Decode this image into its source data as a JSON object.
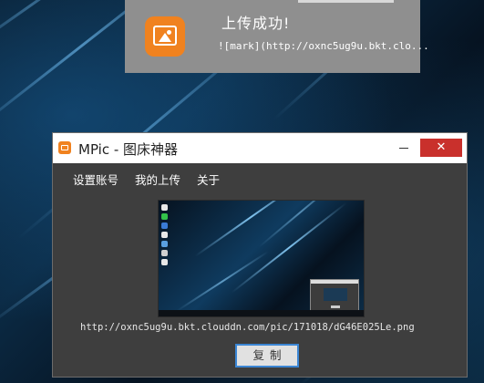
{
  "notification": {
    "title": "上传成功!",
    "message": "![mark](http://oxnc5ug9u.bkt.clo...",
    "icon": "image-icon",
    "accent": "#f0821f"
  },
  "window": {
    "title": "MPic - 图床神器",
    "minimize_label": "",
    "close_label": "✕",
    "menu": [
      "设置账号",
      "我的上传",
      "关于"
    ],
    "uploaded_url": "http://oxnc5ug9u.bkt.clouddn.com/pic/171018/dG46E025Le.png",
    "copy_label": "复制",
    "close_color": "#c9302c",
    "app_icon_color": "#f0821f"
  }
}
